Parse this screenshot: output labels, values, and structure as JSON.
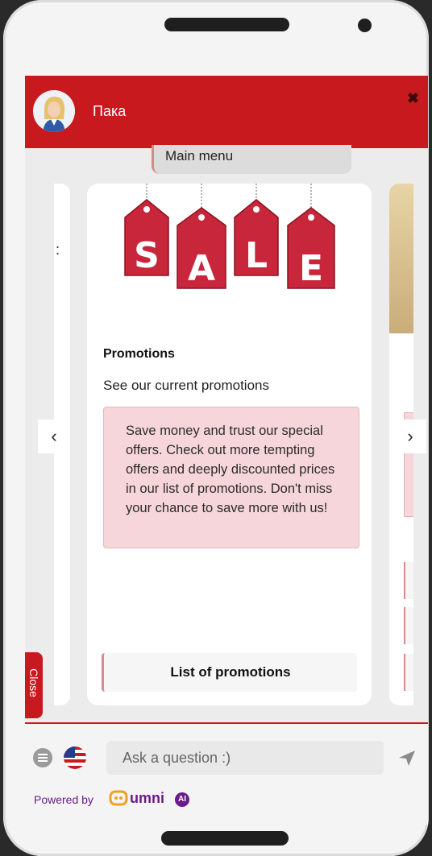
{
  "header": {
    "bot_name": "Пака",
    "close_symbol": "✖"
  },
  "main_menu": {
    "label": "Main menu"
  },
  "card": {
    "image_text": [
      "S",
      "A",
      "L",
      "E"
    ],
    "title": "Promotions",
    "subtitle": "See our current promotions",
    "description": "Save money and trust our special offers. Check out more tempting offers and deeply discounted prices in our list of promotions. Don't miss your chance to save more with us!",
    "button_label": "List of promotions"
  },
  "carousel": {
    "prev_symbol": "‹",
    "next_symbol": "›"
  },
  "close_tab": {
    "label": "Close"
  },
  "composer": {
    "placeholder": "Ask a question :)"
  },
  "branding": {
    "powered_by": "Powered by",
    "brand": "umni",
    "ai_badge": "AI"
  },
  "colors": {
    "brand_red": "#c8191e",
    "promo_bg": "#f6d6da",
    "brand_purple": "#6a1a8a"
  },
  "icons": [
    "avatar-icon",
    "close-icon",
    "chevron-left-icon",
    "chevron-right-icon",
    "menu-icon",
    "us-flag-icon",
    "send-icon",
    "umni-logo-icon"
  ]
}
